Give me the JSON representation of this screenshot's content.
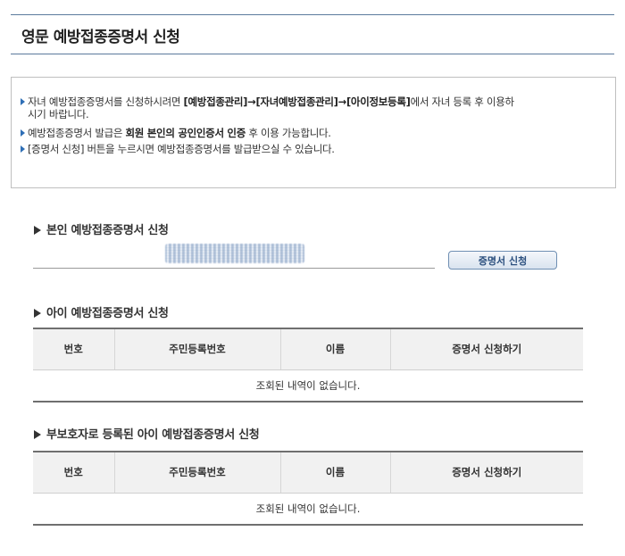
{
  "page": {
    "title": "영문 예방접종증명서 신청"
  },
  "notice": {
    "item1_text_a": "자녀 예방접종증명서를 신청하시려면 ",
    "item1_bold": "[예방접종관리]→[자녀예방접종관리]→[아이정보등록]",
    "item1_text_b": "에서 자녀 등록 후 이용하시기 바랍니다.",
    "item2_text_a": "예방접종증명서 발급은 ",
    "item2_bold": "회원 본인의 공인인증서 인증",
    "item2_text_b": " 후 이용 가능합니다.",
    "item3_text": "[증명서 신청] 버튼을 누르시면 예방접종증명서를 발급받으실 수 있습니다."
  },
  "self_section": {
    "title": "본인 예방접종증명서 신청",
    "button_label": "증명서 신청"
  },
  "child_section": {
    "title": "아이 예방접종증명서 신청",
    "columns": [
      "번호",
      "주민등록번호",
      "이름",
      "증명서 신청하기"
    ],
    "empty_message": "조회된 내역이 없습니다."
  },
  "guardian_section": {
    "title": "부보호자로 등록된 아이 예방접종증명서 신청",
    "columns": [
      "번호",
      "주민등록번호",
      "이름",
      "증명서 신청하기"
    ],
    "empty_message": "조회된 내역이 없습니다."
  },
  "colors": {
    "title_border": "#5b7a9c",
    "bullet": "#2f6fb6",
    "button_text": "#2b4f7e"
  }
}
